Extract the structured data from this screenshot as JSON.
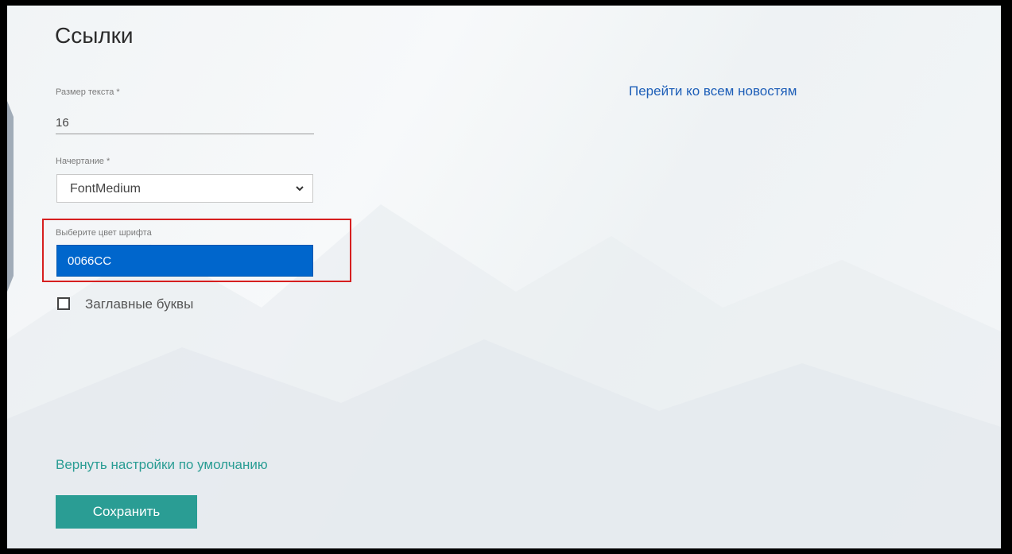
{
  "page": {
    "title": "Ссылки"
  },
  "form": {
    "text_size": {
      "label": "Размер текста *",
      "value": "16"
    },
    "style": {
      "label": "Начертание *",
      "selected": "FontMedium"
    },
    "font_color": {
      "label": "Выберите цвет шрифта",
      "value": "0066CC",
      "color": "#0066cc"
    },
    "uppercase": {
      "label": "Заглавные буквы",
      "checked": false
    }
  },
  "links": {
    "all_news": "Перейти ко всем новостям",
    "reset_defaults": "Вернуть настройки по умолчанию"
  },
  "actions": {
    "save_label": "Сохранить"
  },
  "colors": {
    "accent_teal": "#2a9d94",
    "link_blue": "#1e5fb8",
    "highlight_red": "#d61f1f"
  }
}
